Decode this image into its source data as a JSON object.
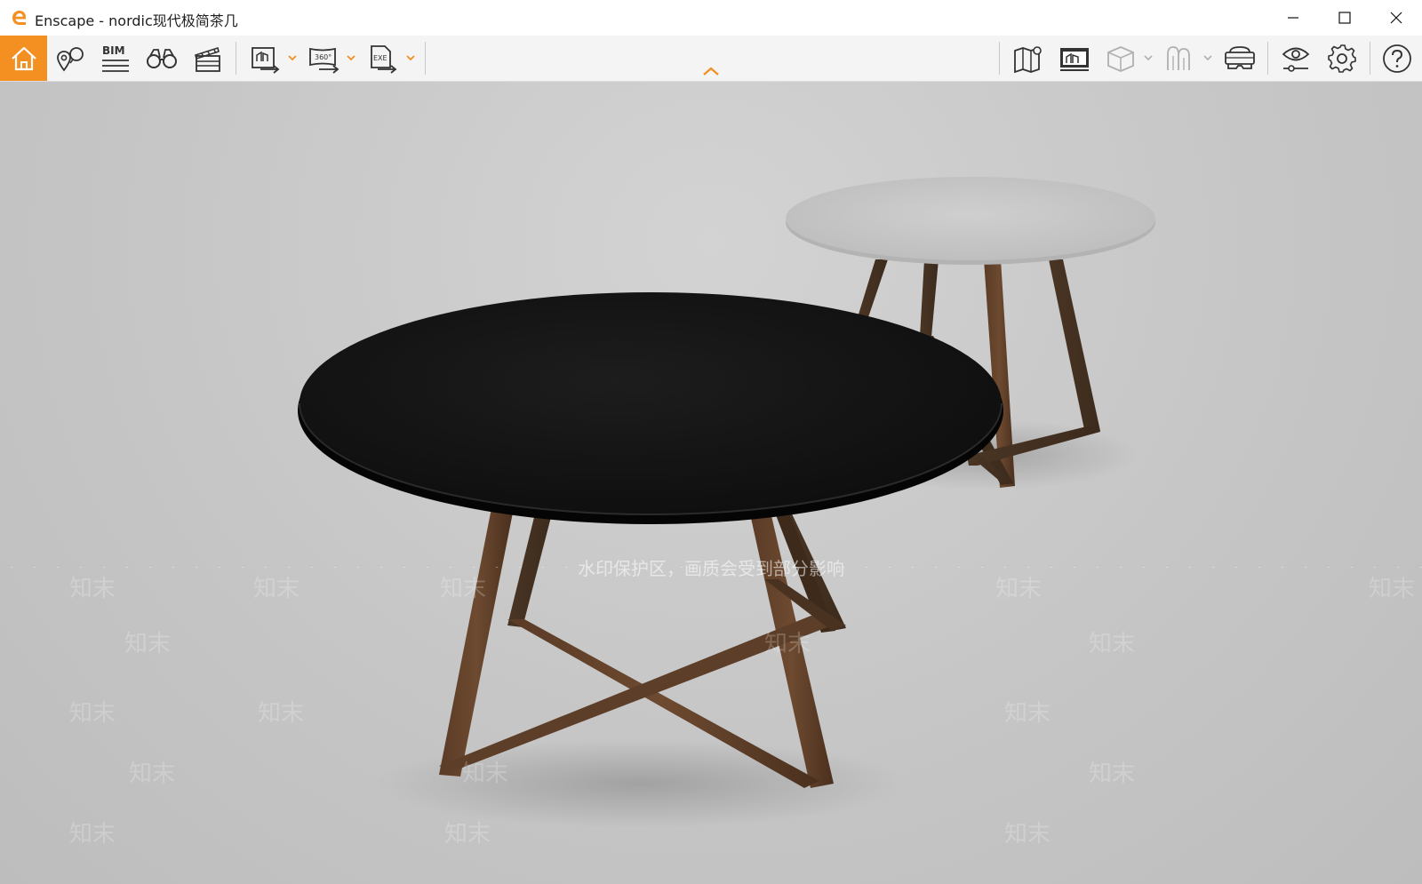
{
  "window": {
    "title": "Enscape - nordic现代极简茶几",
    "accent_color": "#f39021"
  },
  "window_controls": [
    {
      "name": "minimize-button",
      "icon": "minimize-icon"
    },
    {
      "name": "maximize-button",
      "icon": "maximize-icon"
    },
    {
      "name": "close-button",
      "icon": "close-icon"
    }
  ],
  "toolbar": {
    "left_buttons": [
      {
        "name": "home",
        "icon": "home-icon",
        "active": true
      },
      {
        "name": "views",
        "icon": "map-pin-icon"
      },
      {
        "name": "bim",
        "icon": "bim-icon",
        "text": "BIM"
      },
      {
        "name": "walk",
        "icon": "binoculars-icon"
      },
      {
        "name": "video-editor",
        "icon": "clapperboard-icon"
      }
    ],
    "export_buttons": [
      {
        "name": "screenshot-export",
        "icon": "image-export-icon",
        "has_dropdown": true
      },
      {
        "name": "panorama-export",
        "icon": "panorama-export-icon",
        "text": "360°",
        "has_dropdown": true
      },
      {
        "name": "exe-export",
        "icon": "exe-export-icon",
        "text": "EXE",
        "has_dropdown": true
      }
    ],
    "right_buttons": [
      {
        "name": "map",
        "icon": "map-icon"
      },
      {
        "name": "web-standalone",
        "icon": "monitor-icon"
      },
      {
        "name": "asset-library",
        "icon": "cube-icon",
        "has_dropdown": true
      },
      {
        "name": "material-editor",
        "icon": "material-icon",
        "has_dropdown": true
      },
      {
        "name": "vr-headset",
        "icon": "vr-headset-icon"
      },
      {
        "name": "visual-settings",
        "icon": "eye-settings-icon"
      },
      {
        "name": "general-settings",
        "icon": "gear-icon"
      },
      {
        "name": "help",
        "icon": "help-icon"
      }
    ],
    "collapse_icon": "chevron-up-icon"
  },
  "viewport": {
    "watermark_band": "水印保护区，画质会受到部分影响",
    "watermark_mark": "知末"
  }
}
